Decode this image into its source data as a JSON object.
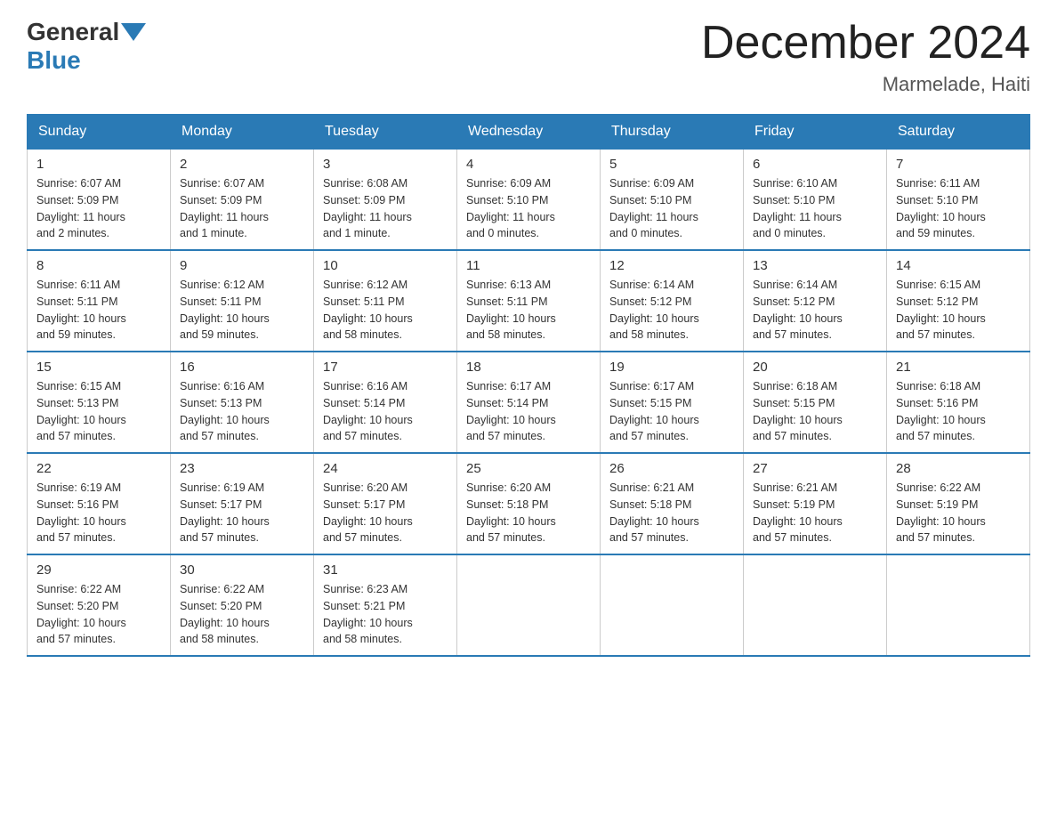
{
  "logo": {
    "general": "General",
    "blue": "Blue"
  },
  "title": "December 2024",
  "subtitle": "Marmelade, Haiti",
  "headers": [
    "Sunday",
    "Monday",
    "Tuesday",
    "Wednesday",
    "Thursday",
    "Friday",
    "Saturday"
  ],
  "weeks": [
    [
      {
        "day": "1",
        "info": "Sunrise: 6:07 AM\nSunset: 5:09 PM\nDaylight: 11 hours\nand 2 minutes."
      },
      {
        "day": "2",
        "info": "Sunrise: 6:07 AM\nSunset: 5:09 PM\nDaylight: 11 hours\nand 1 minute."
      },
      {
        "day": "3",
        "info": "Sunrise: 6:08 AM\nSunset: 5:09 PM\nDaylight: 11 hours\nand 1 minute."
      },
      {
        "day": "4",
        "info": "Sunrise: 6:09 AM\nSunset: 5:10 PM\nDaylight: 11 hours\nand 0 minutes."
      },
      {
        "day": "5",
        "info": "Sunrise: 6:09 AM\nSunset: 5:10 PM\nDaylight: 11 hours\nand 0 minutes."
      },
      {
        "day": "6",
        "info": "Sunrise: 6:10 AM\nSunset: 5:10 PM\nDaylight: 11 hours\nand 0 minutes."
      },
      {
        "day": "7",
        "info": "Sunrise: 6:11 AM\nSunset: 5:10 PM\nDaylight: 10 hours\nand 59 minutes."
      }
    ],
    [
      {
        "day": "8",
        "info": "Sunrise: 6:11 AM\nSunset: 5:11 PM\nDaylight: 10 hours\nand 59 minutes."
      },
      {
        "day": "9",
        "info": "Sunrise: 6:12 AM\nSunset: 5:11 PM\nDaylight: 10 hours\nand 59 minutes."
      },
      {
        "day": "10",
        "info": "Sunrise: 6:12 AM\nSunset: 5:11 PM\nDaylight: 10 hours\nand 58 minutes."
      },
      {
        "day": "11",
        "info": "Sunrise: 6:13 AM\nSunset: 5:11 PM\nDaylight: 10 hours\nand 58 minutes."
      },
      {
        "day": "12",
        "info": "Sunrise: 6:14 AM\nSunset: 5:12 PM\nDaylight: 10 hours\nand 58 minutes."
      },
      {
        "day": "13",
        "info": "Sunrise: 6:14 AM\nSunset: 5:12 PM\nDaylight: 10 hours\nand 57 minutes."
      },
      {
        "day": "14",
        "info": "Sunrise: 6:15 AM\nSunset: 5:12 PM\nDaylight: 10 hours\nand 57 minutes."
      }
    ],
    [
      {
        "day": "15",
        "info": "Sunrise: 6:15 AM\nSunset: 5:13 PM\nDaylight: 10 hours\nand 57 minutes."
      },
      {
        "day": "16",
        "info": "Sunrise: 6:16 AM\nSunset: 5:13 PM\nDaylight: 10 hours\nand 57 minutes."
      },
      {
        "day": "17",
        "info": "Sunrise: 6:16 AM\nSunset: 5:14 PM\nDaylight: 10 hours\nand 57 minutes."
      },
      {
        "day": "18",
        "info": "Sunrise: 6:17 AM\nSunset: 5:14 PM\nDaylight: 10 hours\nand 57 minutes."
      },
      {
        "day": "19",
        "info": "Sunrise: 6:17 AM\nSunset: 5:15 PM\nDaylight: 10 hours\nand 57 minutes."
      },
      {
        "day": "20",
        "info": "Sunrise: 6:18 AM\nSunset: 5:15 PM\nDaylight: 10 hours\nand 57 minutes."
      },
      {
        "day": "21",
        "info": "Sunrise: 6:18 AM\nSunset: 5:16 PM\nDaylight: 10 hours\nand 57 minutes."
      }
    ],
    [
      {
        "day": "22",
        "info": "Sunrise: 6:19 AM\nSunset: 5:16 PM\nDaylight: 10 hours\nand 57 minutes."
      },
      {
        "day": "23",
        "info": "Sunrise: 6:19 AM\nSunset: 5:17 PM\nDaylight: 10 hours\nand 57 minutes."
      },
      {
        "day": "24",
        "info": "Sunrise: 6:20 AM\nSunset: 5:17 PM\nDaylight: 10 hours\nand 57 minutes."
      },
      {
        "day": "25",
        "info": "Sunrise: 6:20 AM\nSunset: 5:18 PM\nDaylight: 10 hours\nand 57 minutes."
      },
      {
        "day": "26",
        "info": "Sunrise: 6:21 AM\nSunset: 5:18 PM\nDaylight: 10 hours\nand 57 minutes."
      },
      {
        "day": "27",
        "info": "Sunrise: 6:21 AM\nSunset: 5:19 PM\nDaylight: 10 hours\nand 57 minutes."
      },
      {
        "day": "28",
        "info": "Sunrise: 6:22 AM\nSunset: 5:19 PM\nDaylight: 10 hours\nand 57 minutes."
      }
    ],
    [
      {
        "day": "29",
        "info": "Sunrise: 6:22 AM\nSunset: 5:20 PM\nDaylight: 10 hours\nand 57 minutes."
      },
      {
        "day": "30",
        "info": "Sunrise: 6:22 AM\nSunset: 5:20 PM\nDaylight: 10 hours\nand 58 minutes."
      },
      {
        "day": "31",
        "info": "Sunrise: 6:23 AM\nSunset: 5:21 PM\nDaylight: 10 hours\nand 58 minutes."
      },
      null,
      null,
      null,
      null
    ]
  ]
}
